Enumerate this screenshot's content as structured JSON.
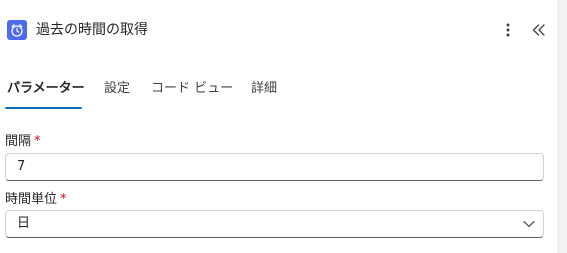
{
  "header": {
    "title": "過去の時間の取得",
    "app_icon": "alarm-clock-icon",
    "more_icon": "more-vertical-icon",
    "collapse_icon": "double-chevron-left-icon",
    "accent_color": "#4f6bed"
  },
  "tabs": [
    {
      "label": "パラメーター",
      "active": true
    },
    {
      "label": "設定",
      "active": false
    },
    {
      "label": "コード ビュー",
      "active": false
    },
    {
      "label": "詳細",
      "active": false
    }
  ],
  "fields": {
    "interval": {
      "label": "間隔",
      "required_mark": "*",
      "value": "7"
    },
    "time_unit": {
      "label": "時間単位",
      "required_mark": "*",
      "value": "日",
      "icon": "chevron-down-icon"
    }
  },
  "colors": {
    "tab_underline": "#0f6cbd",
    "required": "#c50f1f"
  }
}
